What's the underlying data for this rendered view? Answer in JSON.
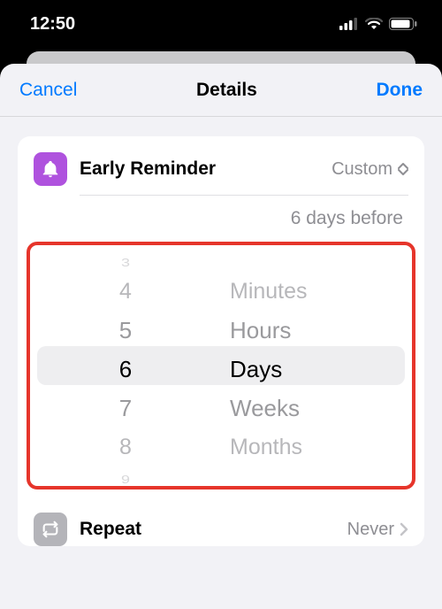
{
  "status": {
    "time": "12:50"
  },
  "nav": {
    "cancel": "Cancel",
    "title": "Details",
    "done": "Done"
  },
  "early": {
    "label": "Early Reminder",
    "mode": "Custom",
    "summary": "6 days before",
    "picker_numbers": [
      "3",
      "4",
      "5",
      "6",
      "7",
      "8",
      "9"
    ],
    "picker_units": [
      "Minutes",
      "Hours",
      "Days",
      "Weeks",
      "Months"
    ],
    "selected_number": "6",
    "selected_unit": "Days"
  },
  "repeat": {
    "label": "Repeat",
    "value": "Never"
  }
}
